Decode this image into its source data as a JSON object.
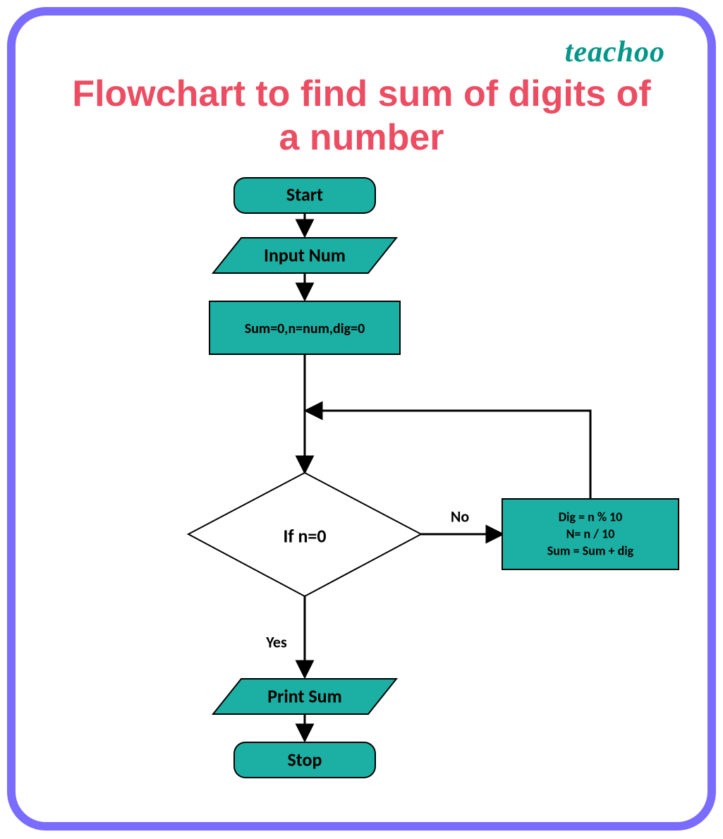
{
  "brand": "teachoo",
  "title_line1": "Flowchart to find sum of digits of",
  "title_line2": "a number",
  "nodes": {
    "start": "Start",
    "input": "Input Num",
    "init": "Sum=0,n=num,dig=0",
    "decision": "If  n=0",
    "process_l1": "Dig = n % 10",
    "process_l2": "N= n / 10",
    "process_l3": "Sum =  Sum + dig",
    "print": "Print Sum",
    "stop": "Stop"
  },
  "labels": {
    "no": "No",
    "yes": "Yes"
  },
  "colors": {
    "teal": "#1bb0a3",
    "black": "#000000"
  }
}
